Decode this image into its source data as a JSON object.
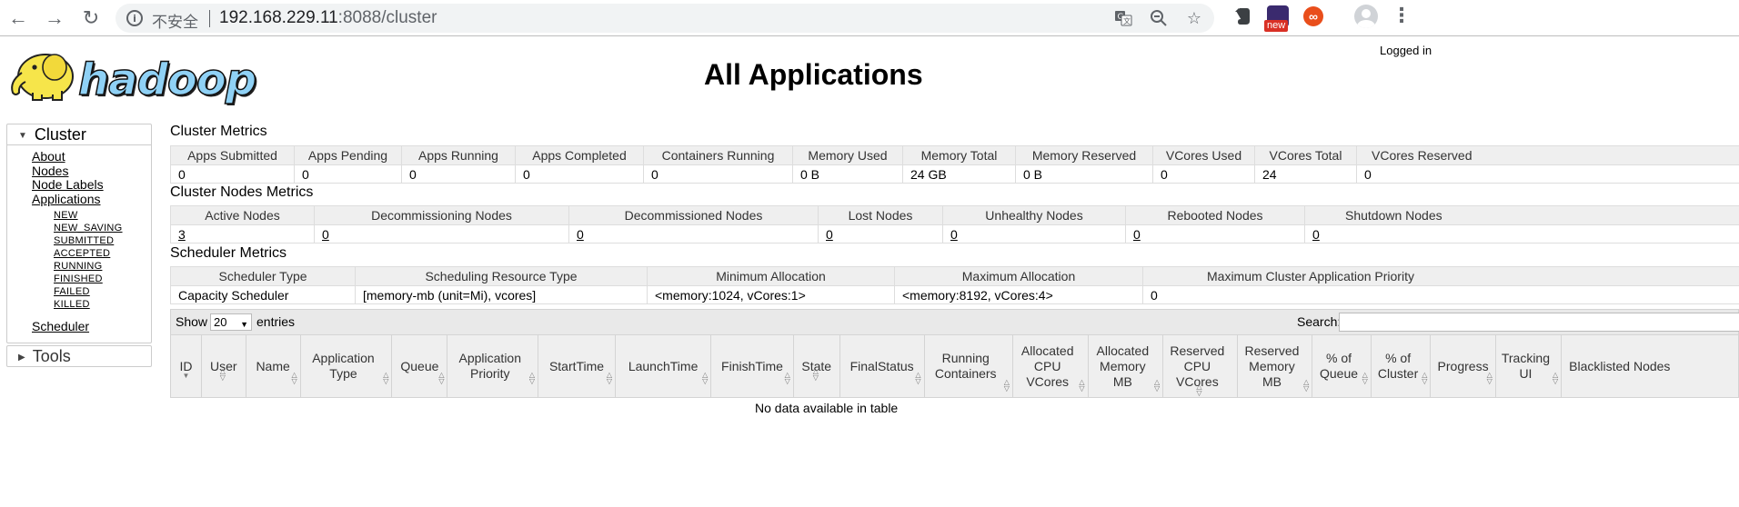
{
  "browser": {
    "insecure_label": "不安全",
    "url_host": "192.168.229.11",
    "url_rest": ":8088/cluster",
    "ext_badge": "new"
  },
  "header": {
    "logged_in": "Logged in",
    "title": "All Applications"
  },
  "nav": {
    "cluster_label": "Cluster",
    "tools_label": "Tools",
    "links": [
      "About",
      "Nodes",
      "Node Labels",
      "Applications",
      "Scheduler"
    ],
    "states": [
      "NEW",
      "NEW_SAVING",
      "SUBMITTED",
      "ACCEPTED",
      "RUNNING",
      "FINISHED",
      "FAILED",
      "KILLED"
    ]
  },
  "cluster_metrics": {
    "title": "Cluster Metrics",
    "headers": [
      "Apps Submitted",
      "Apps Pending",
      "Apps Running",
      "Apps Completed",
      "Containers Running",
      "Memory Used",
      "Memory Total",
      "Memory Reserved",
      "VCores Used",
      "VCores Total",
      "VCores Reserved"
    ],
    "values": [
      "0",
      "0",
      "0",
      "0",
      "0",
      "0 B",
      "24 GB",
      "0 B",
      "0",
      "24",
      "0"
    ]
  },
  "node_metrics": {
    "title": "Cluster Nodes Metrics",
    "headers": [
      "Active Nodes",
      "Decommissioning Nodes",
      "Decommissioned Nodes",
      "Lost Nodes",
      "Unhealthy Nodes",
      "Rebooted Nodes",
      "Shutdown Nodes"
    ],
    "values": [
      "3",
      "0",
      "0",
      "0",
      "0",
      "0",
      "0"
    ]
  },
  "scheduler_metrics": {
    "title": "Scheduler Metrics",
    "headers": [
      "Scheduler Type",
      "Scheduling Resource Type",
      "Minimum Allocation",
      "Maximum Allocation",
      "Maximum Cluster Application Priority"
    ],
    "values": [
      "Capacity Scheduler",
      "[memory-mb (unit=Mi), vcores]",
      "<memory:1024, vCores:1>",
      "<memory:8192, vCores:4>",
      "0"
    ]
  },
  "apps": {
    "show_label": "Show",
    "entries_value": "20",
    "entries_label": "entries",
    "search_label": "Search:",
    "columns": [
      "ID",
      "User",
      "Name",
      "Application Type",
      "Queue",
      "Application Priority",
      "StartTime",
      "LaunchTime",
      "FinishTime",
      "State",
      "FinalStatus",
      "Running Containers",
      "Allocated CPU VCores",
      "Allocated Memory MB",
      "Reserved CPU VCores",
      "Reserved Memory MB",
      "% of Queue",
      "% of Cluster",
      "Progress",
      "Tracking UI",
      "Blacklisted Nodes"
    ],
    "empty_message": "No data available in table"
  }
}
